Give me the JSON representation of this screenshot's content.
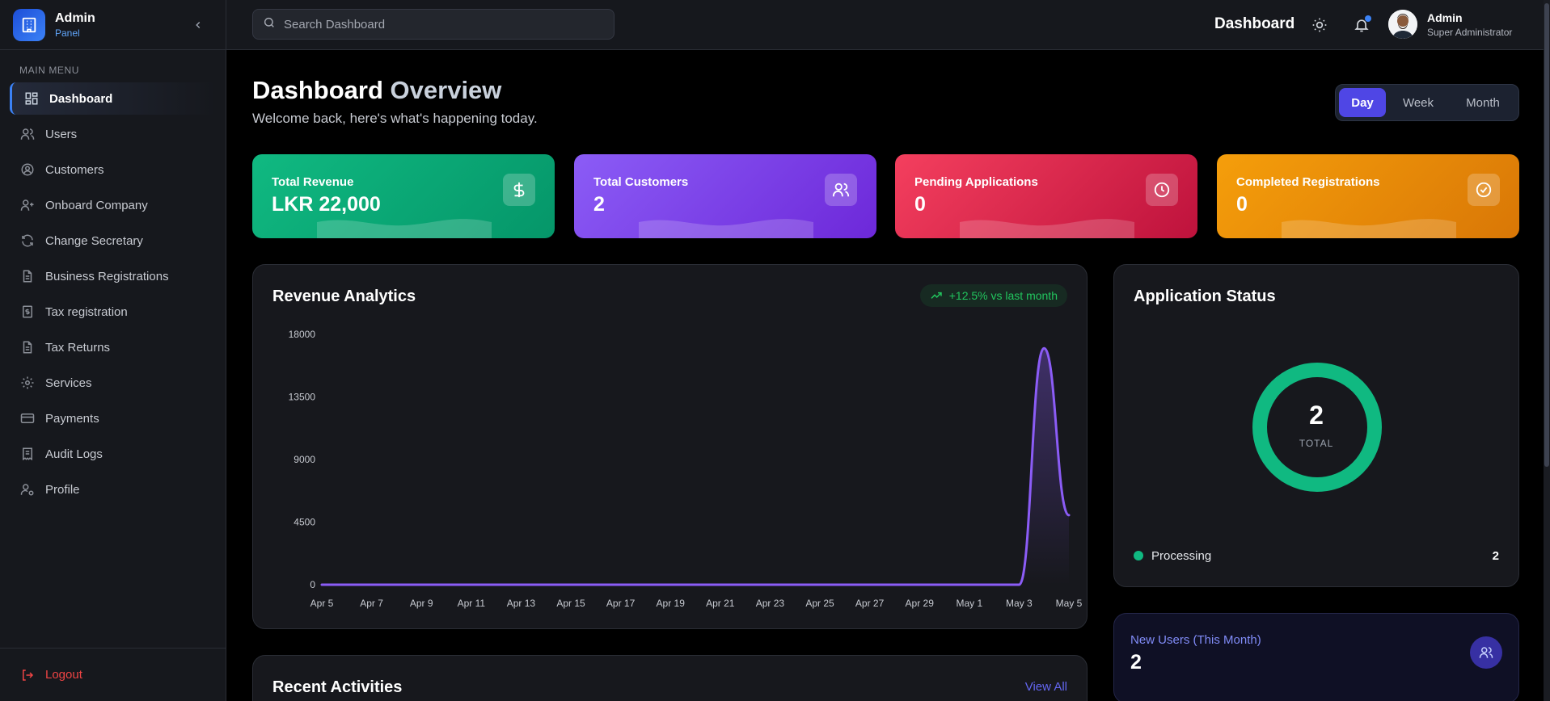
{
  "brand": {
    "title": "Admin",
    "subtitle": "Panel"
  },
  "sidebar": {
    "menu_title": "MAIN MENU",
    "items": [
      {
        "label": "Dashboard",
        "icon": "dashboard-icon"
      },
      {
        "label": "Users",
        "icon": "users-icon"
      },
      {
        "label": "Customers",
        "icon": "user-circle-icon"
      },
      {
        "label": "Onboard Company",
        "icon": "user-plus-icon"
      },
      {
        "label": "Change Secretary",
        "icon": "refresh-icon"
      },
      {
        "label": "Business Registrations",
        "icon": "document-icon"
      },
      {
        "label": "Tax registration",
        "icon": "dollar-document-icon"
      },
      {
        "label": "Tax Returns",
        "icon": "document-icon"
      },
      {
        "label": "Services",
        "icon": "gear-icon"
      },
      {
        "label": "Payments",
        "icon": "credit-card-icon"
      },
      {
        "label": "Audit Logs",
        "icon": "receipt-icon"
      },
      {
        "label": "Profile",
        "icon": "user-cog-icon"
      }
    ],
    "logout_label": "Logout"
  },
  "header": {
    "search_placeholder": "Search Dashboard",
    "title": "Dashboard",
    "user_name": "Admin",
    "user_role": "Super Administrator"
  },
  "main": {
    "title_part1": "Dashboard",
    "title_part2": "Overview",
    "subtitle": "Welcome back, here's what's happening today.",
    "periods": [
      "Day",
      "Week",
      "Month"
    ],
    "active_period": "Day"
  },
  "stats": [
    {
      "label": "Total Revenue",
      "value": "LKR 22,000",
      "icon": "dollar-icon",
      "color": "#10b981"
    },
    {
      "label": "Total Customers",
      "value": "2",
      "icon": "users-icon",
      "color": "#7c3aed"
    },
    {
      "label": "Pending Applications",
      "value": "0",
      "icon": "clock-icon",
      "color": "#e11d48"
    },
    {
      "label": "Completed Registrations",
      "value": "0",
      "icon": "check-circle-icon",
      "color": "#f59e0b"
    }
  ],
  "revenue": {
    "title": "Revenue Analytics",
    "trend": "+12.5% vs last month"
  },
  "chart_data": {
    "type": "area",
    "title": "Revenue Analytics",
    "x": [
      "Apr 5",
      "Apr 6",
      "Apr 7",
      "Apr 8",
      "Apr 9",
      "Apr 10",
      "Apr 11",
      "Apr 12",
      "Apr 13",
      "Apr 14",
      "Apr 15",
      "Apr 16",
      "Apr 17",
      "Apr 18",
      "Apr 19",
      "Apr 20",
      "Apr 21",
      "Apr 22",
      "Apr 23",
      "Apr 24",
      "Apr 25",
      "Apr 26",
      "Apr 27",
      "Apr 28",
      "Apr 29",
      "Apr 30",
      "May 1",
      "May 2",
      "May 3",
      "May 4",
      "May 5"
    ],
    "x_tick_labels": [
      "Apr 5",
      "Apr 7",
      "Apr 9",
      "Apr 11",
      "Apr 13",
      "Apr 15",
      "Apr 17",
      "Apr 19",
      "Apr 21",
      "Apr 23",
      "Apr 25",
      "Apr 27",
      "Apr 29",
      "May 1",
      "May 3",
      "May 5"
    ],
    "series": [
      {
        "values": [
          0,
          0,
          0,
          0,
          0,
          0,
          0,
          0,
          0,
          0,
          0,
          0,
          0,
          0,
          0,
          0,
          0,
          0,
          0,
          0,
          0,
          0,
          0,
          0,
          0,
          0,
          0,
          0,
          0,
          17000,
          5000
        ]
      }
    ],
    "y_ticks": [
      0,
      4500,
      9000,
      13500,
      18000
    ],
    "ylim": [
      0,
      18000
    ],
    "line_color": "#8b5cf6",
    "grid": false
  },
  "status": {
    "title": "Application Status",
    "total": "2",
    "total_label": "TOTAL",
    "legend": [
      {
        "label": "Processing",
        "count": "2",
        "color": "#10b981"
      }
    ]
  },
  "new_users": {
    "label": "New Users (This Month)",
    "value": "2"
  },
  "recent": {
    "title": "Recent Activities",
    "view_all": "View All"
  }
}
